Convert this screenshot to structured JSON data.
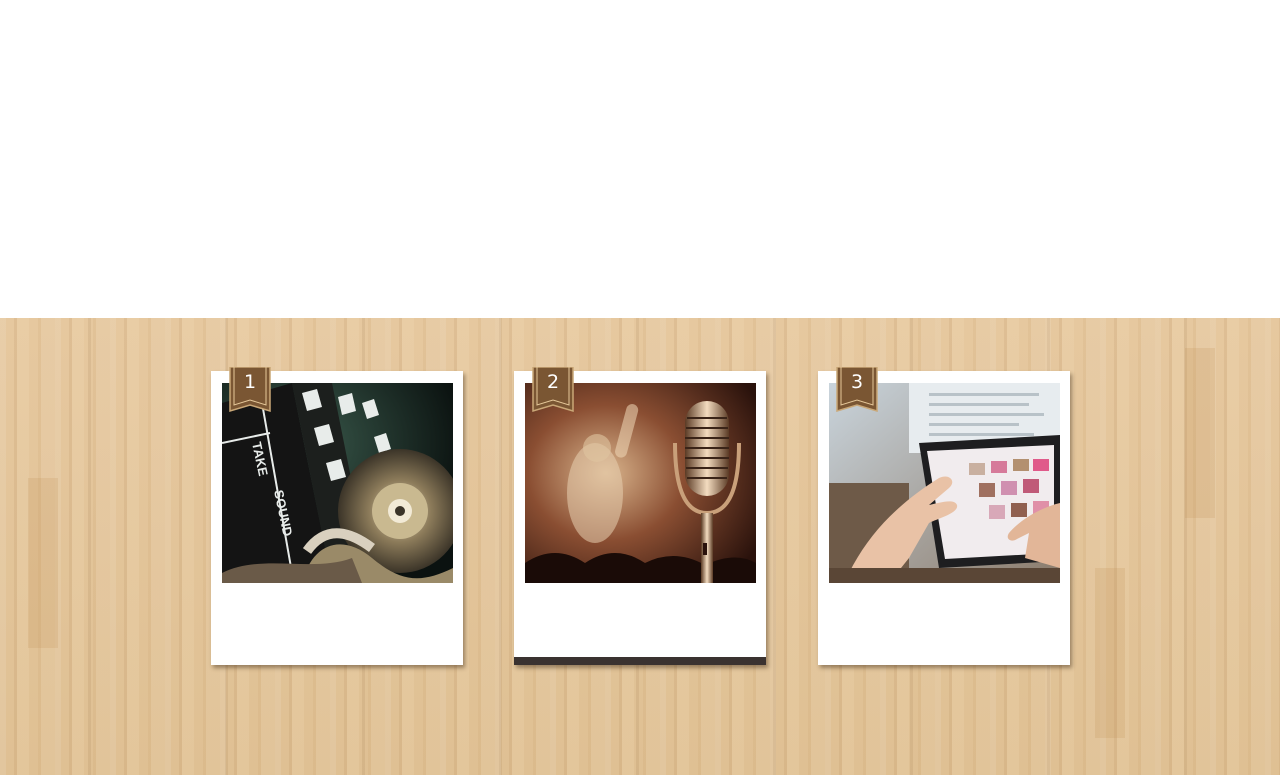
{
  "cards": [
    {
      "number": "1",
      "image": "film-clapperboard-and-reel",
      "active": false
    },
    {
      "number": "2",
      "image": "vintage-microphone-concert",
      "active": true
    },
    {
      "number": "3",
      "image": "hands-on-tablet",
      "active": false
    }
  ],
  "colors": {
    "ribbon": "#7a5633",
    "active_bar": "#3a3230",
    "wood": "#e3c59b"
  }
}
